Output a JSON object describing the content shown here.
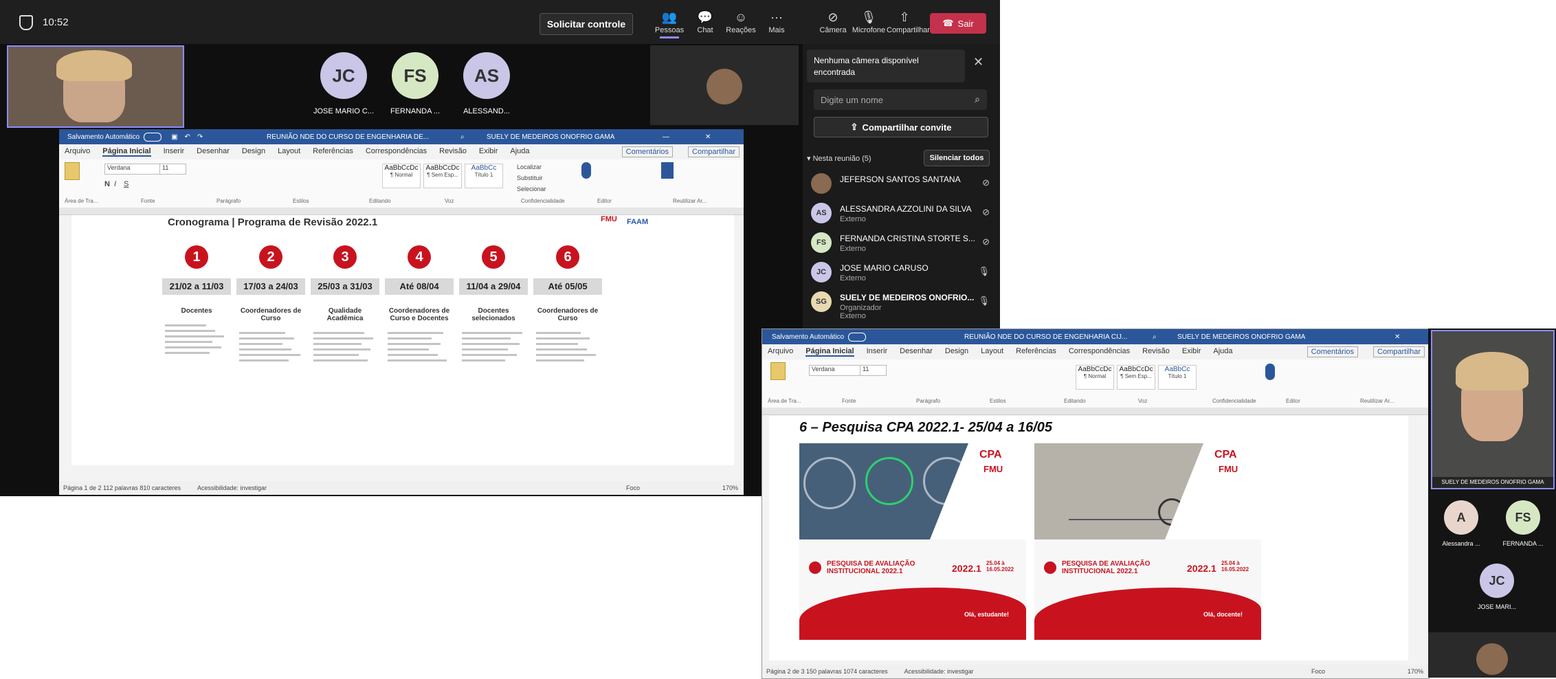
{
  "teams": {
    "time": "10:52",
    "request_control": "Solicitar controle",
    "toolbar": [
      {
        "label": "Pessoas",
        "icon": "people-icon"
      },
      {
        "label": "Chat",
        "icon": "chat-icon"
      },
      {
        "label": "Reações",
        "icon": "reactions-icon"
      },
      {
        "label": "Mais",
        "icon": "more-icon"
      },
      {
        "label": "Câmera",
        "icon": "camera-off-icon"
      },
      {
        "label": "Microfone",
        "icon": "mic-off-icon"
      },
      {
        "label": "Compartilhar",
        "icon": "share-icon"
      }
    ],
    "leave": "Sair",
    "participants_strip": [
      {
        "initials": "JC",
        "name": "JOSE MARIO C...",
        "color": "#c9c6e8"
      },
      {
        "initials": "FS",
        "name": "FERNANDA ...",
        "color": "#d6e8c3"
      },
      {
        "initials": "AS",
        "name": "ALESSAND...",
        "color": "#c9c6e8"
      }
    ]
  },
  "panel": {
    "no_camera": "Nenhuma câmera disponível encontrada",
    "search_placeholder": "Digite um nome",
    "share_invite": "Compartilhar convite",
    "in_meeting": "Nesta reunião (5)",
    "mute_all": "Silenciar todos",
    "people": [
      {
        "initials": "",
        "name": "JEFERSON SANTOS SANTANA",
        "sub": "",
        "color": "#8a6a50"
      },
      {
        "initials": "AS",
        "name": "ALESSANDRA AZZOLINI DA SILVA",
        "sub": "Externo",
        "color": "#c9c6e8"
      },
      {
        "initials": "FS",
        "name": "FERNANDA CRISTINA STORTE S...",
        "sub": "Externo",
        "color": "#d6e8c3"
      },
      {
        "initials": "JC",
        "name": "JOSE MARIO CARUSO",
        "sub": "Externo",
        "color": "#c9c6e8"
      },
      {
        "initials": "SG",
        "name": "SUELY DE MEDEIROS ONOFRIO...",
        "sub": "Organizador\nExterno",
        "color": "#e8d9b0"
      }
    ]
  },
  "word1": {
    "autosave": "Salvamento Automático",
    "title": "REUNIÃO NDE DO CURSO DE ENGENHARIA DE...",
    "user": "SUELY DE MEDEIROS ONOFRIO GAMA",
    "menu": [
      "Arquivo",
      "Página Inicial",
      "Inserir",
      "Desenhar",
      "Design",
      "Layout",
      "Referências",
      "Correspondências",
      "Revisão",
      "Exibir",
      "Ajuda"
    ],
    "comments": "Comentários",
    "share": "Compartilhar",
    "font": "Verdana",
    "size": "11",
    "styles": [
      {
        "preview": "AaBbCcDc",
        "name": "¶ Normal"
      },
      {
        "preview": "AaBbCcDc",
        "name": "¶ Sem Esp..."
      },
      {
        "preview": "AaBbCc",
        "name": "Título 1"
      }
    ],
    "groups": [
      "Área de Tra...",
      "Fonte",
      "Parágrafo",
      "Estilos",
      "Editando",
      "Voz",
      "Confidencialidade",
      "Editor",
      "Reutilizar Ar..."
    ],
    "editing": [
      "Localizar",
      "Substituir",
      "Selecionar"
    ],
    "heading": "Cronograma | Programa de Revisão 2022.1",
    "steps": [
      {
        "n": "1",
        "date": "21/02 a 11/03",
        "role": "Docentes"
      },
      {
        "n": "2",
        "date": "17/03 a 24/03",
        "role": "Coordenadores de Curso"
      },
      {
        "n": "3",
        "date": "25/03 a 31/03",
        "role": "Qualidade Acadêmica"
      },
      {
        "n": "4",
        "date": "Até 08/04",
        "role": "Coordenadores de Curso e Docentes"
      },
      {
        "n": "5",
        "date": "11/04 a 29/04",
        "role": "Docentes selecionados"
      },
      {
        "n": "6",
        "date": "Até 05/05",
        "role": "Coordenadores de Curso"
      }
    ],
    "status": "Página 1 de 2    112 palavras    810 caracteres",
    "accessibility": "Acessibilidade: investigar",
    "focus": "Foco",
    "zoom": "170%"
  },
  "word2": {
    "autosave": "Salvamento Automático",
    "title": "REUNIÃO NDE DO CURSO DE ENGENHARIA CIJ...",
    "user": "SUELY DE MEDEIROS ONOFRIO GAMA",
    "heading": "6 – Pesquisa CPA 2022.1- 25/04 a 16/05",
    "card_title": "PESQUISA DE AVALIAÇÃO INSTITUCIONAL 2022.1",
    "card_year": "2022.1",
    "card_dates": "25.04 à 16.05.2022",
    "card1_cta": "Olá, estudante!",
    "card2_cta": "Olá, docente!",
    "logo_cpa": "CPA",
    "logo_fmu": "FMU",
    "status": "Página 2 de 3    150 palavras    1074 caracteres",
    "zoom": "170%"
  },
  "gallery": {
    "self_name": "SUELY DE MEDEIROS ONOFRIO GAMA",
    "people": [
      {
        "initials": "A",
        "name": "Alessandra ...",
        "color": "#e8d6cc"
      },
      {
        "initials": "FS",
        "name": "FERNANDA ...",
        "color": "#d6e8c3"
      },
      {
        "initials": "JC",
        "name": "JOSE MARI...",
        "color": "#c9c6e8"
      }
    ]
  }
}
